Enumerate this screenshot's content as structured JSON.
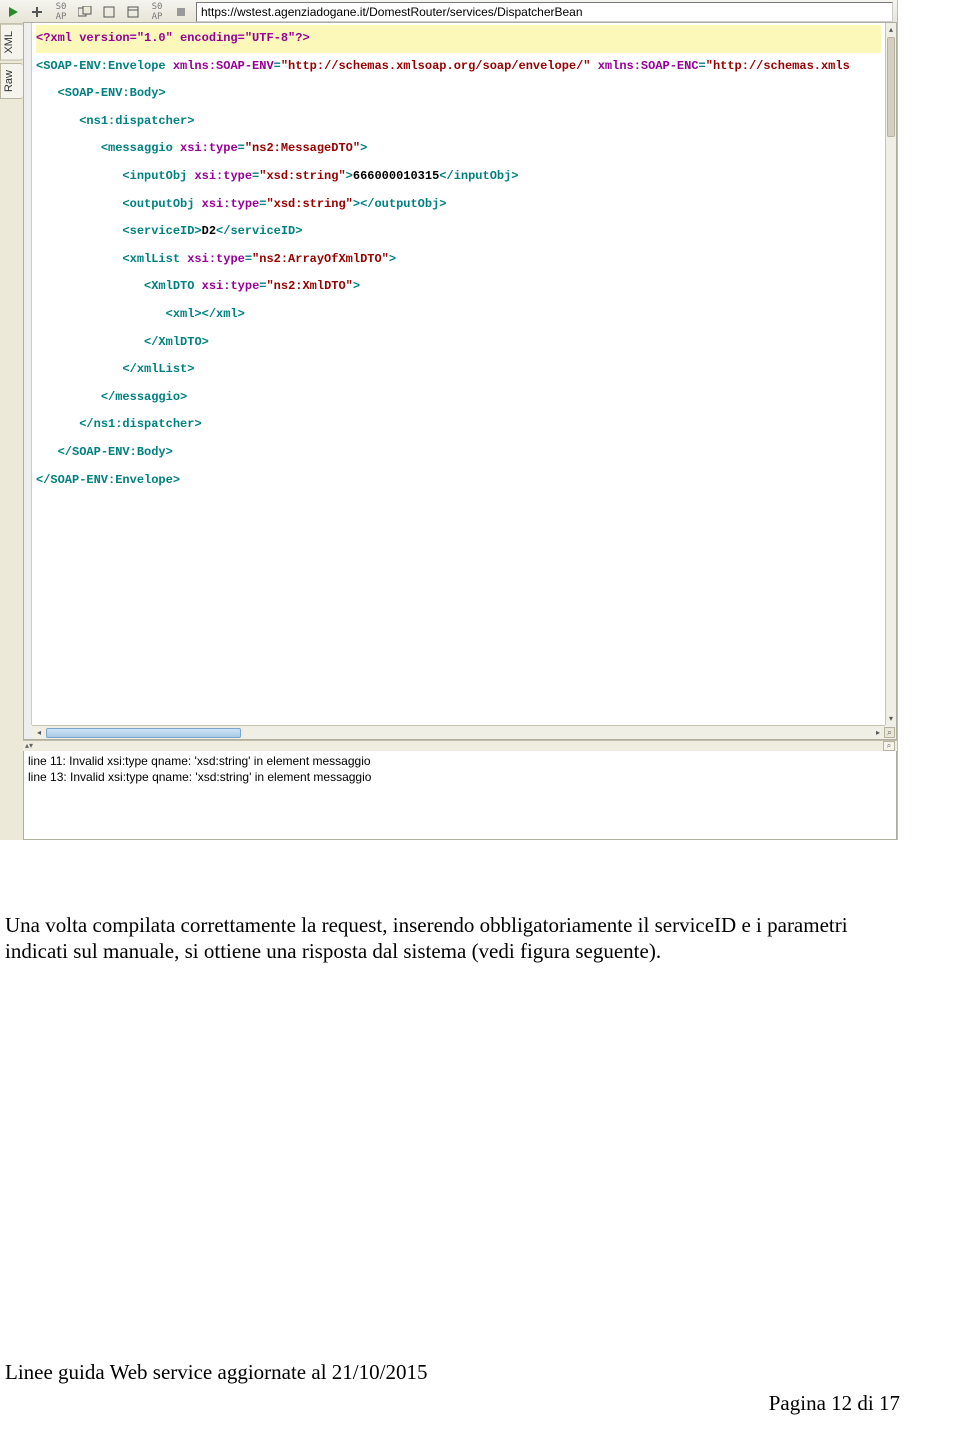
{
  "toolbar": {
    "url": "https://wstest.agenziadogane.it/DomestRouter/services/DispatcherBean"
  },
  "side_tabs": {
    "xml": "XML",
    "raw": "Raw"
  },
  "xml": {
    "line1": "<?xml version=\"1.0\" encoding=\"UTF-8\"?>",
    "env_open": "<SOAP-ENV:Envelope",
    "env_attr1_name": "xmlns:SOAP-ENV",
    "env_attr1_val": "\"http://schemas.xmlsoap.org/soap/envelope/\"",
    "env_attr2_name": "xmlns:SOAP-ENC",
    "env_attr2_val": "\"http://schemas.xmls",
    "body_open": "<SOAP-ENV:Body>",
    "disp_open": "<ns1:dispatcher>",
    "msg_open": "<messaggio",
    "msg_attr_name": "xsi:type",
    "msg_attr_val": "\"ns2:MessageDTO\"",
    "input_open": "<inputObj",
    "input_attr_val": "\"xsd:string\"",
    "input_text": "666000010315",
    "input_close": "</inputObj>",
    "output_open": "<outputObj",
    "output_attr_val": "\"xsd:string\"",
    "output_close": "></outputObj>",
    "svc_open": "<serviceID>",
    "svc_text": "D2",
    "svc_close": "</serviceID>",
    "xmllist_open": "<xmlList",
    "xmllist_attr_val": "\"ns2:ArrayOfXmlDTO\"",
    "xmldto_open": "<XmlDTO",
    "xmldto_attr_val": "\"ns2:XmlDTO\"",
    "xml_inner": "<xml></xml>",
    "xmldto_close": "</XmlDTO>",
    "xmllist_close": "</xmlList>",
    "msg_close": "</messaggio>",
    "disp_close": "</ns1:dispatcher>",
    "body_close": "</SOAP-ENV:Body>",
    "env_close": "</SOAP-ENV:Envelope>"
  },
  "messages": {
    "m1": "line 11: Invalid xsi:type qname: 'xsd:string' in element messaggio",
    "m2": "line 13: Invalid xsi:type qname: 'xsd:string' in element messaggio"
  },
  "doc": {
    "paragraph": "Una volta compilata correttamente la request, inserendo obbligatoriamente il serviceID e i parametri indicati sul manuale, si ottiene una risposta dal sistema (vedi figura seguente).",
    "footer_left": "Linee guida Web service aggiornate al 21/10/2015",
    "footer_right": "Pagina 12 di 17"
  }
}
